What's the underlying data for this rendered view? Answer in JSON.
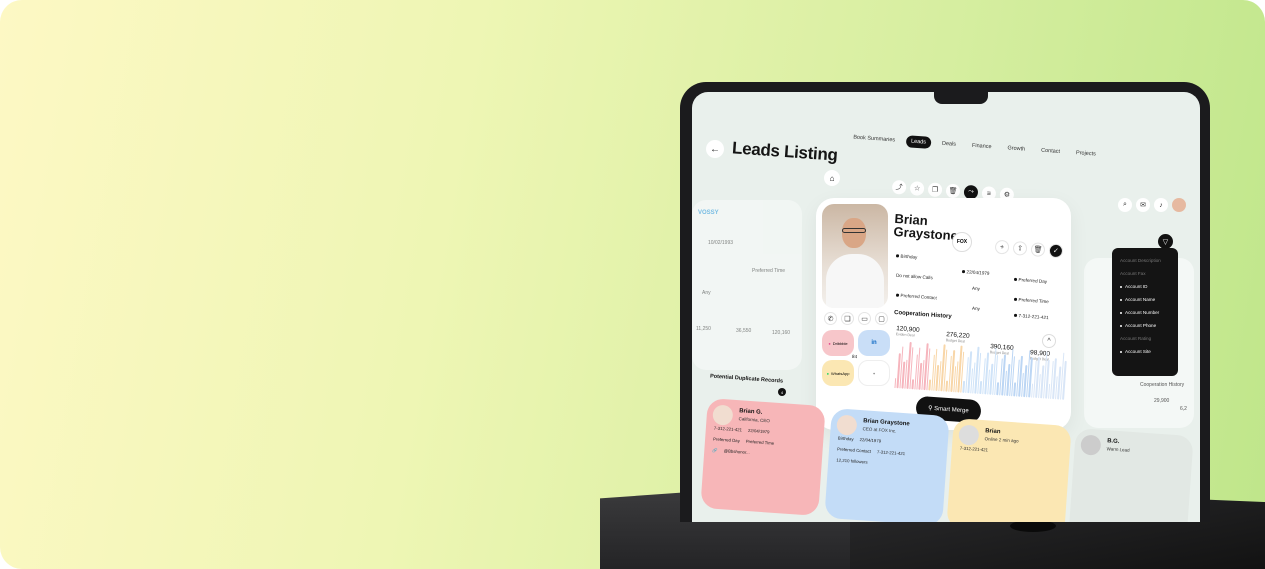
{
  "app": {
    "title": "Leads Listing",
    "tabs": [
      "Book Summaries",
      "Leads",
      "Deals",
      "Finance",
      "Growth",
      "Contact",
      "Projects"
    ],
    "active_tab": "Leads"
  },
  "ghost_left": {
    "brand": "VOSSY",
    "date": "10/02/1993",
    "preferred_time": "Preferred Time",
    "any": "Any",
    "values": [
      "11,250",
      "36,550",
      "120,160"
    ]
  },
  "profile": {
    "first_name": "Brian",
    "last_name": "Graystone",
    "company_logo": "FOX",
    "fields": {
      "birthday": "Birthday",
      "birthday_value": "22/04/1979",
      "do_not_allow_calls": "Do not allow Calls",
      "preferred_day": "Preferred Day",
      "preferred_day_value": "Any",
      "preferred_contact": "Preferred Contact",
      "preferred_time": "Preferred Time",
      "preferred_time_value": "Any",
      "phone": "7-312-221-421"
    },
    "cooperation_history": "Cooperation History",
    "stats": [
      {
        "value": "120,900",
        "label": "Eviden Deal"
      },
      {
        "value": "276,220",
        "label": "Budget Deal"
      },
      {
        "value": "390,160",
        "label": "Budget Deal"
      },
      {
        "value": "98,900",
        "label": "Budget Deal"
      }
    ],
    "social": {
      "dribbble": "Dribbble",
      "linkedin": "in",
      "whatsapp": "WhatsApp",
      "count": "84"
    }
  },
  "smart_merge": "Smart Merge",
  "dropdown": {
    "items": [
      {
        "label": "Account Description",
        "dim": true
      },
      {
        "label": "Account Fax",
        "dim": true
      },
      {
        "label": "Account ID",
        "dim": false
      },
      {
        "label": "Account Name",
        "dim": false
      },
      {
        "label": "Account Number",
        "dim": false
      },
      {
        "label": "Account Phone",
        "dim": false
      },
      {
        "label": "Account Rating",
        "dim": true
      },
      {
        "label": "Account Site",
        "dim": false
      }
    ]
  },
  "ghost_right": {
    "cooperation_history": "Cooperation History",
    "values": [
      "29,900",
      "6,2"
    ]
  },
  "duplicates": {
    "title": "Potential Duplicate Records",
    "count": "4",
    "cards": [
      {
        "name": "Brian G.",
        "role": "California, CEO",
        "phone": "7-312-221-421",
        "birthday": "22/04/1979",
        "preferred_day": "Preferred Day",
        "preferred_time": "Preferred Time",
        "handle": "@Bbshonor...",
        "color": "#f7b6b8"
      },
      {
        "name": "Brian Graystone",
        "role": "CEO at FOX Inc.",
        "birthday": "Birthday",
        "birthday_value": "22/04/1979",
        "preferred_contact": "Preferred Contact",
        "phone": "7-312-221-421",
        "followers": "12,210 followers",
        "color": "#c3dcf7"
      },
      {
        "name": "Brian",
        "role": "Online 2 min ago",
        "phone": "7-312-221-421",
        "color": "#fbe7b3"
      },
      {
        "name": "B.G.",
        "role": "Warm Lead",
        "color": "#e2e8e4"
      }
    ]
  },
  "colors": {
    "background_start": "#fdf8c4",
    "background_end": "#bfe68a",
    "accent": "#111111",
    "screen": "#e9f0ec"
  }
}
